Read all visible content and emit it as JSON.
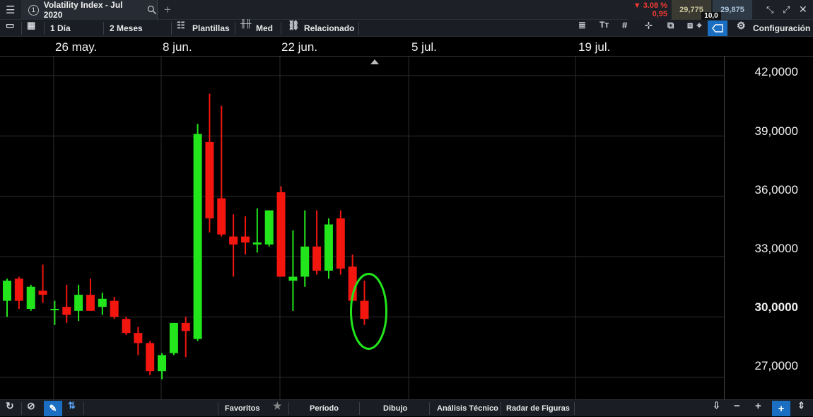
{
  "tab": {
    "index": "1",
    "title": "Volatility Index - Jul 2020"
  },
  "quote": {
    "change_pct": "▼ 3.08 %",
    "change_abs": "0,95",
    "bid": "29,775",
    "ask": "29,875",
    "spread": "10,0"
  },
  "toolbar": {
    "interval": "1 Día",
    "range": "2 Meses",
    "templates": "Plantillas",
    "med": "Med",
    "related": "Relacionado",
    "config": "Configuración"
  },
  "bottom": {
    "favorites": "Favoritos",
    "period": "Período",
    "drawing": "Dibujo",
    "technical": "Análisis Técnico",
    "radar": "Radar de Figuras"
  },
  "colors": {
    "up": "#22e51c",
    "down": "#f2160f",
    "highlight": "#22e51c",
    "accent": "#1b6fc2"
  },
  "chart_data": {
    "type": "candlestick",
    "x_ticks": [
      "26 may.",
      "8 jun.",
      "22 jun.",
      "5 jul.",
      "19 jul."
    ],
    "y_ticks": [
      "42,0000",
      "39,0000",
      "36,0000",
      "33,0000",
      "30,0000",
      "27,0000"
    ],
    "y_tick_values": [
      42,
      39,
      36,
      33,
      30,
      27
    ],
    "ylim": [
      25.9,
      42.95
    ],
    "grid": true,
    "current_label": "30,0000",
    "candles": [
      {
        "o": 30.8,
        "h": 31.9,
        "l": 30.0,
        "c": 31.8
      },
      {
        "o": 31.9,
        "h": 32.0,
        "l": 30.4,
        "c": 30.8
      },
      {
        "o": 30.4,
        "h": 31.6,
        "l": 30.3,
        "c": 31.5
      },
      {
        "o": 31.3,
        "h": 32.6,
        "l": 30.7,
        "c": 31.1
      },
      {
        "o": 30.4,
        "h": 30.8,
        "l": 29.6,
        "c": 30.4
      },
      {
        "o": 30.5,
        "h": 31.6,
        "l": 29.7,
        "c": 30.1
      },
      {
        "o": 30.3,
        "h": 31.6,
        "l": 29.8,
        "c": 31.1
      },
      {
        "o": 31.1,
        "h": 31.9,
        "l": 30.3,
        "c": 30.3
      },
      {
        "o": 30.5,
        "h": 31.2,
        "l": 30.1,
        "c": 30.9
      },
      {
        "o": 30.8,
        "h": 31.0,
        "l": 29.9,
        "c": 30.0
      },
      {
        "o": 29.9,
        "h": 30.0,
        "l": 29.1,
        "c": 29.2
      },
      {
        "o": 29.2,
        "h": 29.5,
        "l": 28.1,
        "c": 28.7
      },
      {
        "o": 28.7,
        "h": 28.8,
        "l": 27.1,
        "c": 27.3
      },
      {
        "o": 27.3,
        "h": 28.2,
        "l": 26.9,
        "c": 28.1
      },
      {
        "o": 28.2,
        "h": 29.7,
        "l": 28.1,
        "c": 29.7
      },
      {
        "o": 29.7,
        "h": 30.0,
        "l": 28.0,
        "c": 29.3
      },
      {
        "o": 28.9,
        "h": 39.6,
        "l": 28.8,
        "c": 39.1
      },
      {
        "o": 38.7,
        "h": 41.1,
        "l": 34.2,
        "c": 34.9
      },
      {
        "o": 35.9,
        "h": 40.5,
        "l": 34.0,
        "c": 34.1
      },
      {
        "o": 34.0,
        "h": 35.1,
        "l": 32.0,
        "c": 33.6
      },
      {
        "o": 34.0,
        "h": 35.0,
        "l": 33.1,
        "c": 33.7
      },
      {
        "o": 33.6,
        "h": 35.4,
        "l": 33.2,
        "c": 33.7
      },
      {
        "o": 33.6,
        "h": 35.3,
        "l": 33.5,
        "c": 35.3
      },
      {
        "o": 36.2,
        "h": 36.5,
        "l": 32.0,
        "c": 32.0
      },
      {
        "o": 31.8,
        "h": 34.3,
        "l": 30.3,
        "c": 32.0
      },
      {
        "o": 32.0,
        "h": 35.3,
        "l": 31.5,
        "c": 33.5
      },
      {
        "o": 33.5,
        "h": 35.3,
        "l": 32.1,
        "c": 32.3
      },
      {
        "o": 32.3,
        "h": 34.9,
        "l": 31.9,
        "c": 34.6
      },
      {
        "o": 34.9,
        "h": 35.3,
        "l": 32.1,
        "c": 32.4
      },
      {
        "o": 32.5,
        "h": 33.1,
        "l": 30.8,
        "c": 30.8
      },
      {
        "o": 30.8,
        "h": 31.8,
        "l": 29.6,
        "c": 29.9
      }
    ]
  }
}
